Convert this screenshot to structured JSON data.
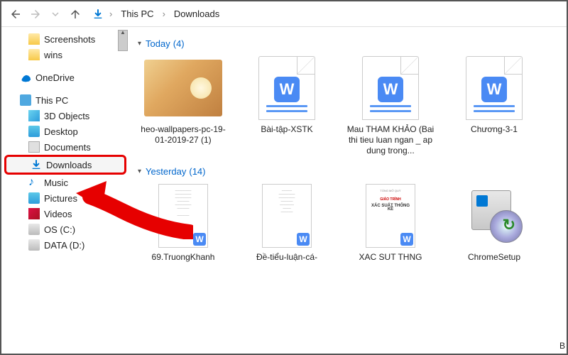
{
  "breadcrumb": {
    "root": "This PC",
    "current": "Downloads"
  },
  "sidebar": {
    "items": [
      {
        "label": "Screenshots",
        "icon": "folder"
      },
      {
        "label": "wins",
        "icon": "folder"
      },
      {
        "label": "OneDrive",
        "icon": "onedrive",
        "section": true
      },
      {
        "label": "This PC",
        "icon": "pc",
        "section": true
      },
      {
        "label": "3D Objects",
        "icon": "obj3d",
        "indent": true
      },
      {
        "label": "Desktop",
        "icon": "desktop",
        "indent": true
      },
      {
        "label": "Documents",
        "icon": "docs",
        "indent": true
      },
      {
        "label": "Downloads",
        "icon": "download",
        "indent": true,
        "highlighted": true
      },
      {
        "label": "Music",
        "icon": "music",
        "indent": true
      },
      {
        "label": "Pictures",
        "icon": "pictures",
        "indent": true
      },
      {
        "label": "Videos",
        "icon": "videos",
        "indent": true
      },
      {
        "label": "OS (C:)",
        "icon": "disk",
        "indent": true
      },
      {
        "label": "DATA (D:)",
        "icon": "disk",
        "indent": true
      }
    ]
  },
  "groups": {
    "today": {
      "label": "Today",
      "count": "(4)"
    },
    "yesterday": {
      "label": "Yesterday",
      "count": "(14)"
    }
  },
  "files": {
    "today": [
      {
        "name": "heo-wallpapers-pc-19-01-2019-27 (1)",
        "type": "image"
      },
      {
        "name": "Bài-tập-XSTK",
        "type": "wps"
      },
      {
        "name": "Mau THAM KHẢO (Bai thi tieu luan ngan _ ap dung trong...",
        "type": "wps"
      },
      {
        "name": "Chương-3-1",
        "type": "wps"
      }
    ],
    "yesterday": [
      {
        "name": "69.TruongKhanh",
        "type": "wps-small"
      },
      {
        "name": "Đề-tiểu-luận-cá-",
        "type": "wps-small"
      },
      {
        "name": "XAC SUT THNG",
        "type": "book",
        "title1": "GIÁO TRÌNH",
        "title2": "XÁC SUẤT THỐNG KÊ"
      },
      {
        "name": "ChromeSetup",
        "type": "installer"
      }
    ]
  },
  "cut_label": "B"
}
